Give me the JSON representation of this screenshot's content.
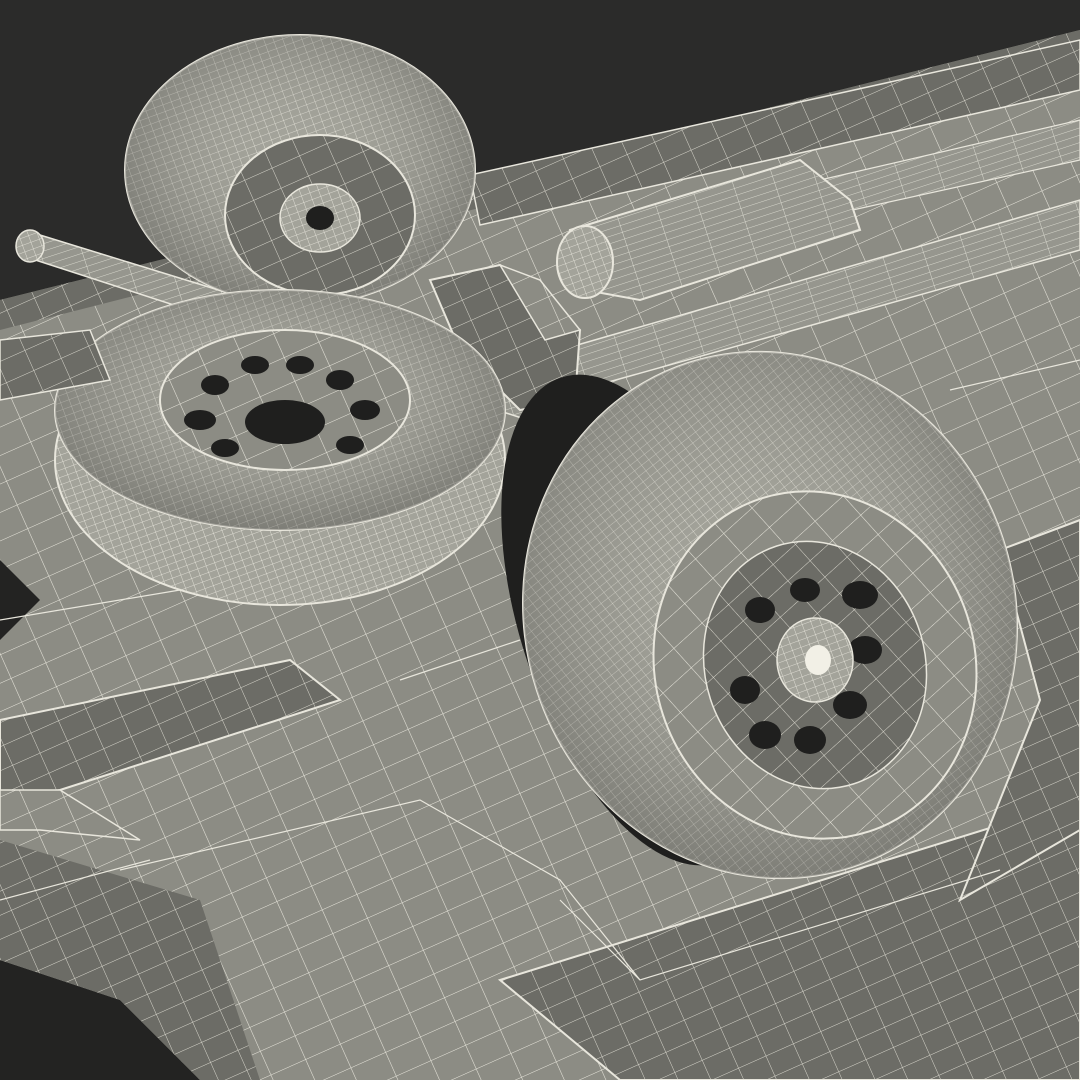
{
  "scene": {
    "background_color": "#2b2b2a",
    "surface_color": "#8c8c84",
    "surface_shadow_color": "#5e5e58",
    "wire_color": "#e8e6dc",
    "tire_color": "#a3a39a",
    "rim_color": "#9a9a92",
    "hole_color": "#1f1f1e"
  },
  "objects": {
    "underbody": "vehicle-underbody-panel",
    "wheel_rear": "rear-wheel",
    "wheel_spare": "spare-tire",
    "wheel_front": "front-wheel",
    "exhaust": "exhaust-pipe",
    "muffler": "muffler",
    "axle": "axle-assembly",
    "jack_left": "jack-lever",
    "side_skirt": "side-skirt"
  }
}
